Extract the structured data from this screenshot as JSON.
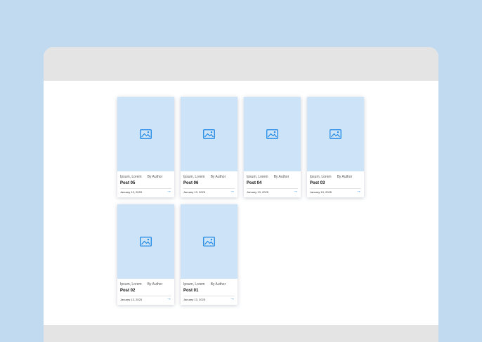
{
  "colors": {
    "page_background": "#c2daf0",
    "window_chrome": "#e4e4e4",
    "thumbnail_background": "#cde3f8",
    "accent": "#1e88e5"
  },
  "posts": [
    {
      "categories": "Ipsum, Lorem",
      "author": "By Author",
      "title": "Post 05",
      "date": "January 13, 2025",
      "icon": "image-placeholder-icon",
      "link_icon": "arrow-right-icon"
    },
    {
      "categories": "Ipsum, Lorem",
      "author": "By Author",
      "title": "Post 06",
      "date": "January 13, 2025",
      "icon": "image-placeholder-icon",
      "link_icon": "arrow-right-icon"
    },
    {
      "categories": "Ipsum, Lorem",
      "author": "By Author",
      "title": "Post 04",
      "date": "January 13, 2025",
      "icon": "image-placeholder-icon",
      "link_icon": "arrow-right-icon"
    },
    {
      "categories": "Ipsum, Lorem",
      "author": "By Author",
      "title": "Post 03",
      "date": "January 13, 2025",
      "icon": "image-placeholder-icon",
      "link_icon": "arrow-right-icon"
    },
    {
      "categories": "Ipsum, Lorem",
      "author": "By Author",
      "title": "Post 02",
      "date": "January 13, 2025",
      "icon": "image-placeholder-icon",
      "link_icon": "arrow-right-icon"
    },
    {
      "categories": "Ipsum, Lorem",
      "author": "By Author",
      "title": "Post 01",
      "date": "January 13, 2025",
      "icon": "image-placeholder-icon",
      "link_icon": "arrow-right-icon"
    }
  ],
  "arrow_glyph": "→"
}
